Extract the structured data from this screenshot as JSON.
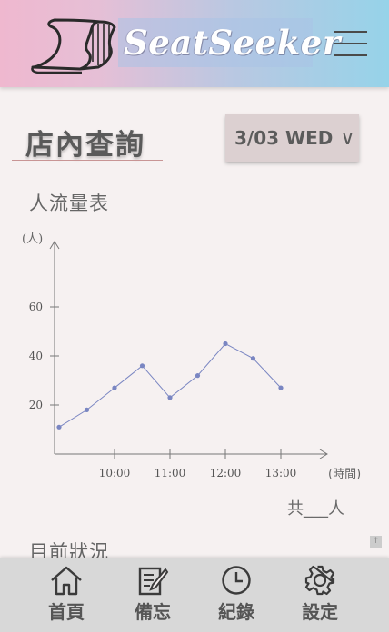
{
  "app": {
    "logo_text": "SeatSeeker"
  },
  "page": {
    "title": "店內查詢",
    "date_label": "3/03 WED"
  },
  "flow_section": {
    "title": "人流量表",
    "total_text": "共___人"
  },
  "status_section": {
    "title": "目前狀況"
  },
  "chart_data": {
    "type": "line",
    "ylabel": "(人)",
    "xlabel": "(時間)",
    "x_ticks": [
      "10:00",
      "11:00",
      "12:00",
      "13:00"
    ],
    "y_ticks": [
      20,
      40,
      60
    ],
    "ylim": [
      0,
      80
    ],
    "x": [
      "09:00",
      "09:30",
      "10:00",
      "10:30",
      "11:00",
      "11:30",
      "12:00",
      "12:30",
      "13:00"
    ],
    "values": [
      11,
      18,
      27,
      36,
      23,
      32,
      45,
      39,
      27
    ],
    "color": "#7a86c2"
  },
  "nav": {
    "items": [
      {
        "label": "首頁",
        "icon": "home-icon"
      },
      {
        "label": "備忘",
        "icon": "memo-icon"
      },
      {
        "label": "紀錄",
        "icon": "clock-icon"
      },
      {
        "label": "設定",
        "icon": "gear-icon"
      }
    ]
  },
  "colors": {
    "header_start": "#efb8cf",
    "header_end": "#96d3e9",
    "background": "#f6f1f1",
    "nav_bg": "#d8d8d8"
  }
}
